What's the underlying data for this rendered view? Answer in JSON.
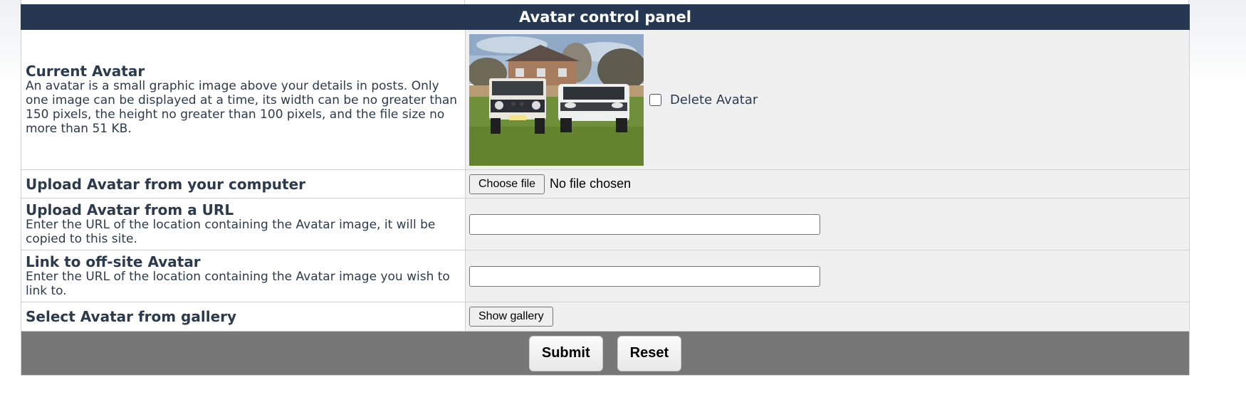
{
  "panel": {
    "title": "Avatar control panel"
  },
  "rows": {
    "current_avatar": {
      "title": "Current Avatar",
      "description": "An avatar is a small graphic image above your details in posts. Only one image can be displayed at a time, its width can be no greater than 150 pixels, the height no greater than 100 pixels, and the file size no more than 51 KB.",
      "delete_label": "Delete Avatar",
      "delete_checked": false
    },
    "upload_computer": {
      "title": "Upload Avatar from your computer",
      "button_label": "Choose file",
      "status": "No file chosen"
    },
    "upload_url": {
      "title": "Upload Avatar from a URL",
      "description": "Enter the URL of the location containing the Avatar image, it will be copied to this site.",
      "value": ""
    },
    "offsite_link": {
      "title": "Link to off-site Avatar",
      "description": "Enter the URL of the location containing the Avatar image you wish to link to.",
      "value": ""
    },
    "gallery": {
      "title": "Select Avatar from gallery",
      "button_label": "Show gallery"
    }
  },
  "footer": {
    "submit_label": "Submit",
    "reset_label": "Reset"
  },
  "colors": {
    "header_bg": "#263851",
    "footer_bg": "#777777",
    "label_text": "#2c3a4e",
    "value_bg": "#f0f0f0"
  }
}
